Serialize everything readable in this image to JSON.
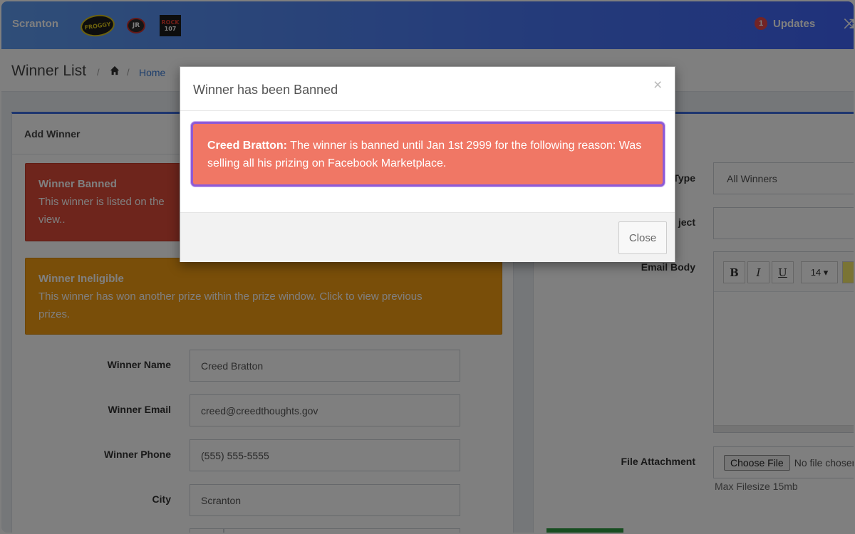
{
  "navbar": {
    "brand": "Scranton",
    "logos": [
      {
        "name": "froggy-logo",
        "text": "FROGGY"
      },
      {
        "name": "jr-logo",
        "text": "JR"
      },
      {
        "name": "rock-107-logo",
        "text_top": "ROCK",
        "text_bottom": "107"
      }
    ],
    "updates_count": "1",
    "updates_label": "Updates",
    "extra_icon": "expand-icon"
  },
  "header": {
    "title": "Winner List",
    "breadcrumb_home": "Home"
  },
  "left_panel": {
    "heading": "Add Winner",
    "alert_banned": {
      "title": "Winner Banned",
      "text": "This winner is listed on the",
      "text2": "view.."
    },
    "alert_ineligible": {
      "title": "Winner Ineligible",
      "text": "This winner has won another prize within the prize window. Click to view previous",
      "text2": "prizes."
    },
    "fields": [
      {
        "label": "Winner Name",
        "value": "Creed Bratton"
      },
      {
        "label": "Winner Email",
        "value": "creed@creedthoughts.gov"
      },
      {
        "label": "Winner Phone",
        "value": "(555) 555-5555"
      },
      {
        "label": "City",
        "value": "Scranton"
      }
    ]
  },
  "right_panel": {
    "type_label": "Type",
    "type_value": "All Winners",
    "subject_label": "ject",
    "body_label": "Email Body",
    "toolbar": {
      "bold": "B",
      "italic": "I",
      "underline": "U",
      "font_size": "14 ▾"
    },
    "file_label": "File Attachment",
    "file_button": "Choose File",
    "file_status": "No file chosen",
    "file_help": "Max Filesize 15mb"
  },
  "modal": {
    "title": "Winner has been Banned",
    "close_symbol": "×",
    "message_name": "Creed Bratton:",
    "message_text": " The winner is banned until Jan 1st 2999 for the following reason: Was selling all his prizing on Facebook Marketplace.",
    "close_button": "Close"
  }
}
